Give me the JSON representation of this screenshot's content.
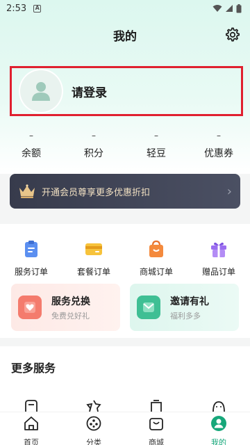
{
  "status_bar": {
    "time": "2:53",
    "notification_icon": "A"
  },
  "header": {
    "title": "我的",
    "settings_icon": "gear-icon"
  },
  "login": {
    "label": "请登录"
  },
  "stats": [
    {
      "value": "–",
      "label": "余额"
    },
    {
      "value": "–",
      "label": "积分"
    },
    {
      "value": "–",
      "label": "轻豆"
    },
    {
      "value": "–",
      "label": "优惠券"
    }
  ],
  "vip_banner": {
    "text": "开通会员尊享更多优惠折扣"
  },
  "orders": [
    {
      "label": "服务订单",
      "icon": "clipboard-icon"
    },
    {
      "label": "套餐订单",
      "icon": "card-icon"
    },
    {
      "label": "商城订单",
      "icon": "bag-icon"
    },
    {
      "label": "赠品订单",
      "icon": "gift-icon"
    }
  ],
  "promos": [
    {
      "title": "服务兑换",
      "subtitle": "免费兑好礼"
    },
    {
      "title": "邀请有礼",
      "subtitle": "福利多多"
    }
  ],
  "more_services": {
    "title": "更多服务"
  },
  "tabs": [
    {
      "label": "首页"
    },
    {
      "label": "分类"
    },
    {
      "label": "商城"
    },
    {
      "label": "我的"
    }
  ],
  "colors": {
    "accent": "#16a77a",
    "highlight_border": "#e0202f",
    "vip_bg": "#3c4052"
  }
}
